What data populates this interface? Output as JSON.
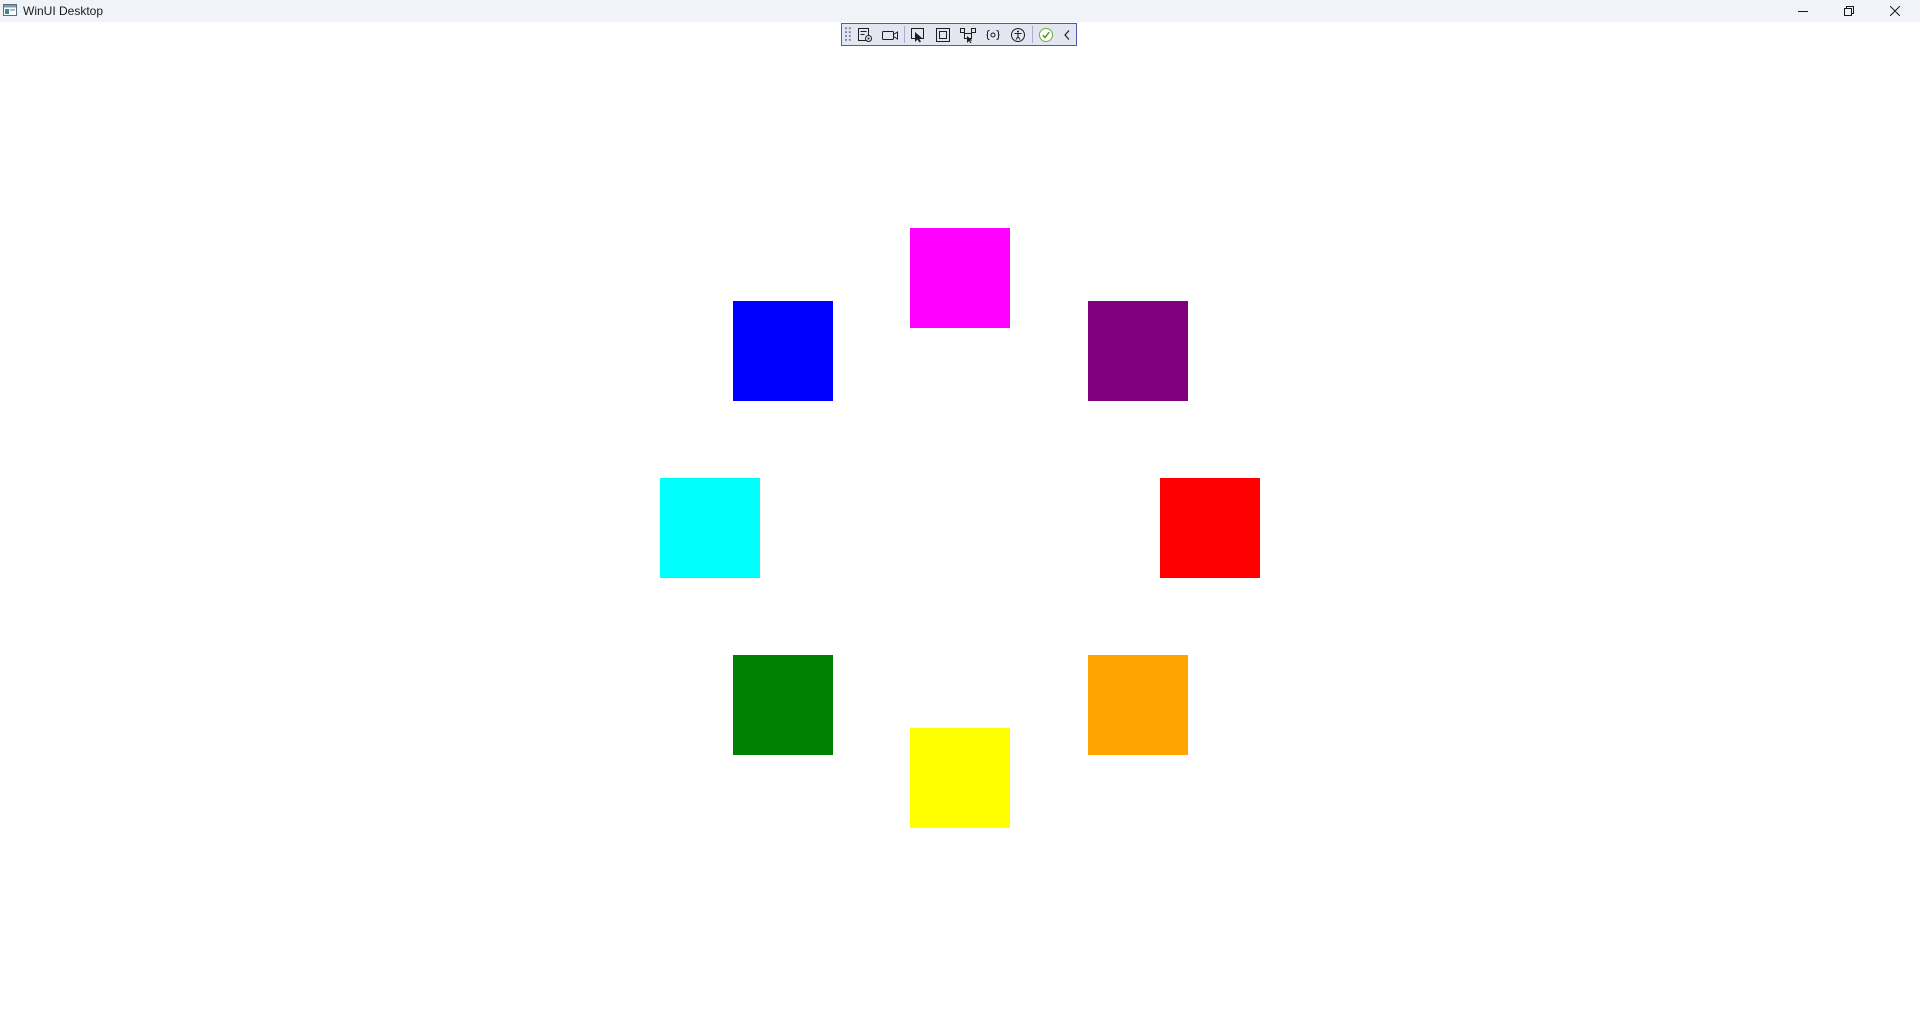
{
  "window": {
    "title": "WinUI Desktop",
    "icon": "app-window-icon",
    "controls": {
      "minimize": "minimize-icon",
      "restore": "restore-icon",
      "close": "close-icon"
    }
  },
  "dev_toolbar": {
    "icons": [
      "live-visual-tree-icon",
      "record-icon",
      "select-element-icon",
      "display-layout-adorners-icon",
      "track-focus-icon",
      "binding-failures-icon",
      "accessibility-icon",
      "hot-reload-status-icon",
      "collapse-toolbar-icon"
    ],
    "accent_color": "#4d5ea8",
    "background_color": "#e3e6f1"
  },
  "squares": [
    {
      "name": "magenta",
      "color": "#ff00ff"
    },
    {
      "name": "purple",
      "color": "#800080"
    },
    {
      "name": "red",
      "color": "#ff0000"
    },
    {
      "name": "orange",
      "color": "#ffa500"
    },
    {
      "name": "yellow",
      "color": "#ffff00"
    },
    {
      "name": "green",
      "color": "#008000"
    },
    {
      "name": "cyan",
      "color": "#00ffff"
    },
    {
      "name": "blue",
      "color": "#0000ff"
    }
  ]
}
